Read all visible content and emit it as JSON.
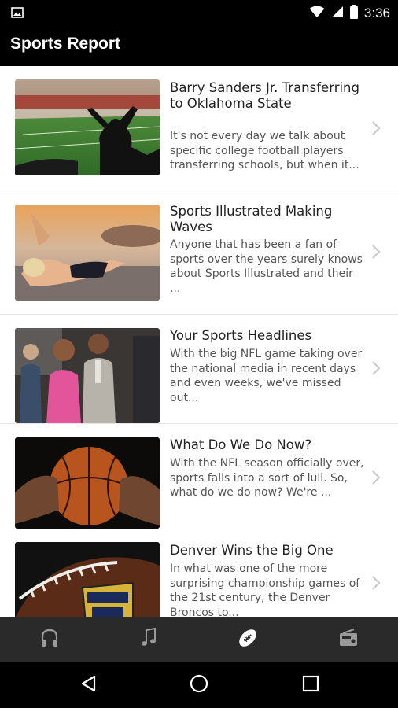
{
  "status_bar": {
    "time": "3:36",
    "icons": [
      "image-icon",
      "wifi-icon",
      "signal-icon",
      "battery-icon"
    ]
  },
  "app_bar": {
    "title": "Sports Report"
  },
  "articles": [
    {
      "title": "Barry Sanders Jr. Transferring to Oklahoma State",
      "snippet": "It's not every day we talk about specific college football players transferring schools, but when it...",
      "image": "stadium-fan-image"
    },
    {
      "title": "Sports Illustrated Making Waves",
      "snippet": "Anyone that has been a fan of sports over the years surely knows about Sports Illustrated and their ...",
      "image": "beach-swimsuit-image"
    },
    {
      "title": "Your Sports Headlines",
      "snippet": "With the big NFL game taking over the national media in recent days and even weeks, we've missed out...",
      "image": "couple-event-image"
    },
    {
      "title": "What Do We Do Now?",
      "snippet": "With the NFL season officially over, sports falls into a sort of lull. So, what do we do now? We're ...",
      "image": "basketball-hands-image"
    },
    {
      "title": "Denver Wins the Big One",
      "snippet": "In what was one of the more surprising championship games of the 21st century, the Denver Broncos to...",
      "image": "nfl-football-image"
    }
  ],
  "tabs": [
    {
      "icon": "headphones-icon",
      "active": false
    },
    {
      "icon": "music-note-icon",
      "active": false
    },
    {
      "icon": "football-icon",
      "active": true
    },
    {
      "icon": "radio-icon",
      "active": false
    }
  ],
  "nav_bar": {
    "buttons": [
      "back-icon",
      "home-icon",
      "recents-icon"
    ]
  },
  "colors": {
    "bars": "#000000",
    "tab_bar": "#2a2a2a",
    "tab_icon": "#9a9a9a",
    "tab_icon_active": "#ffffff"
  }
}
